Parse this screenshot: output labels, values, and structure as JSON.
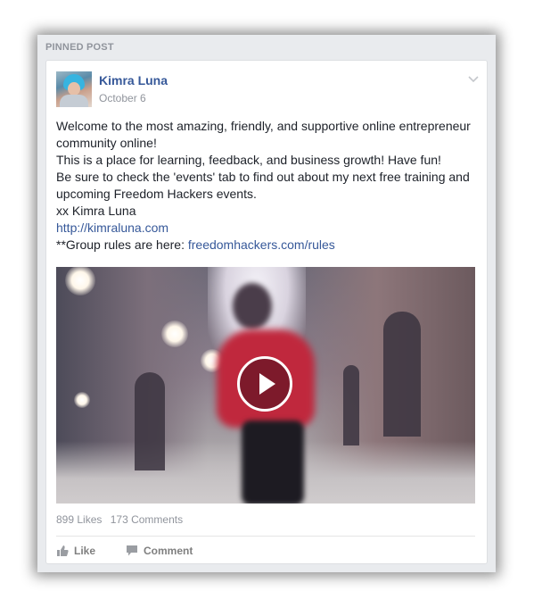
{
  "section_label": "PINNED POST",
  "post": {
    "author": "Kimra Luna",
    "date": "October 6",
    "body_lines": [
      "Welcome to the most amazing, friendly, and supportive online entrepreneur community online!",
      "This is a place for learning, feedback, and business growth! Have fun!",
      "Be sure to check the 'events' tab to find out about my next free training and upcoming Freedom Hackers events.",
      "xx Kimra Luna"
    ],
    "link": "http://kimraluna.com",
    "rules_prefix": "**Group rules are here: ",
    "rules_link": "freedomhackers.com/rules"
  },
  "stats": {
    "likes": "899 Likes",
    "comments": "173 Comments"
  },
  "actions": {
    "like_label": "Like",
    "comment_label": "Comment"
  },
  "icons": {
    "options": "chevron-down-icon",
    "play": "play-icon",
    "like": "thumbs-up-icon",
    "comment": "speech-bubble-icon"
  },
  "colors": {
    "link": "#365899",
    "text": "#1d2129",
    "muted": "#90949c"
  }
}
